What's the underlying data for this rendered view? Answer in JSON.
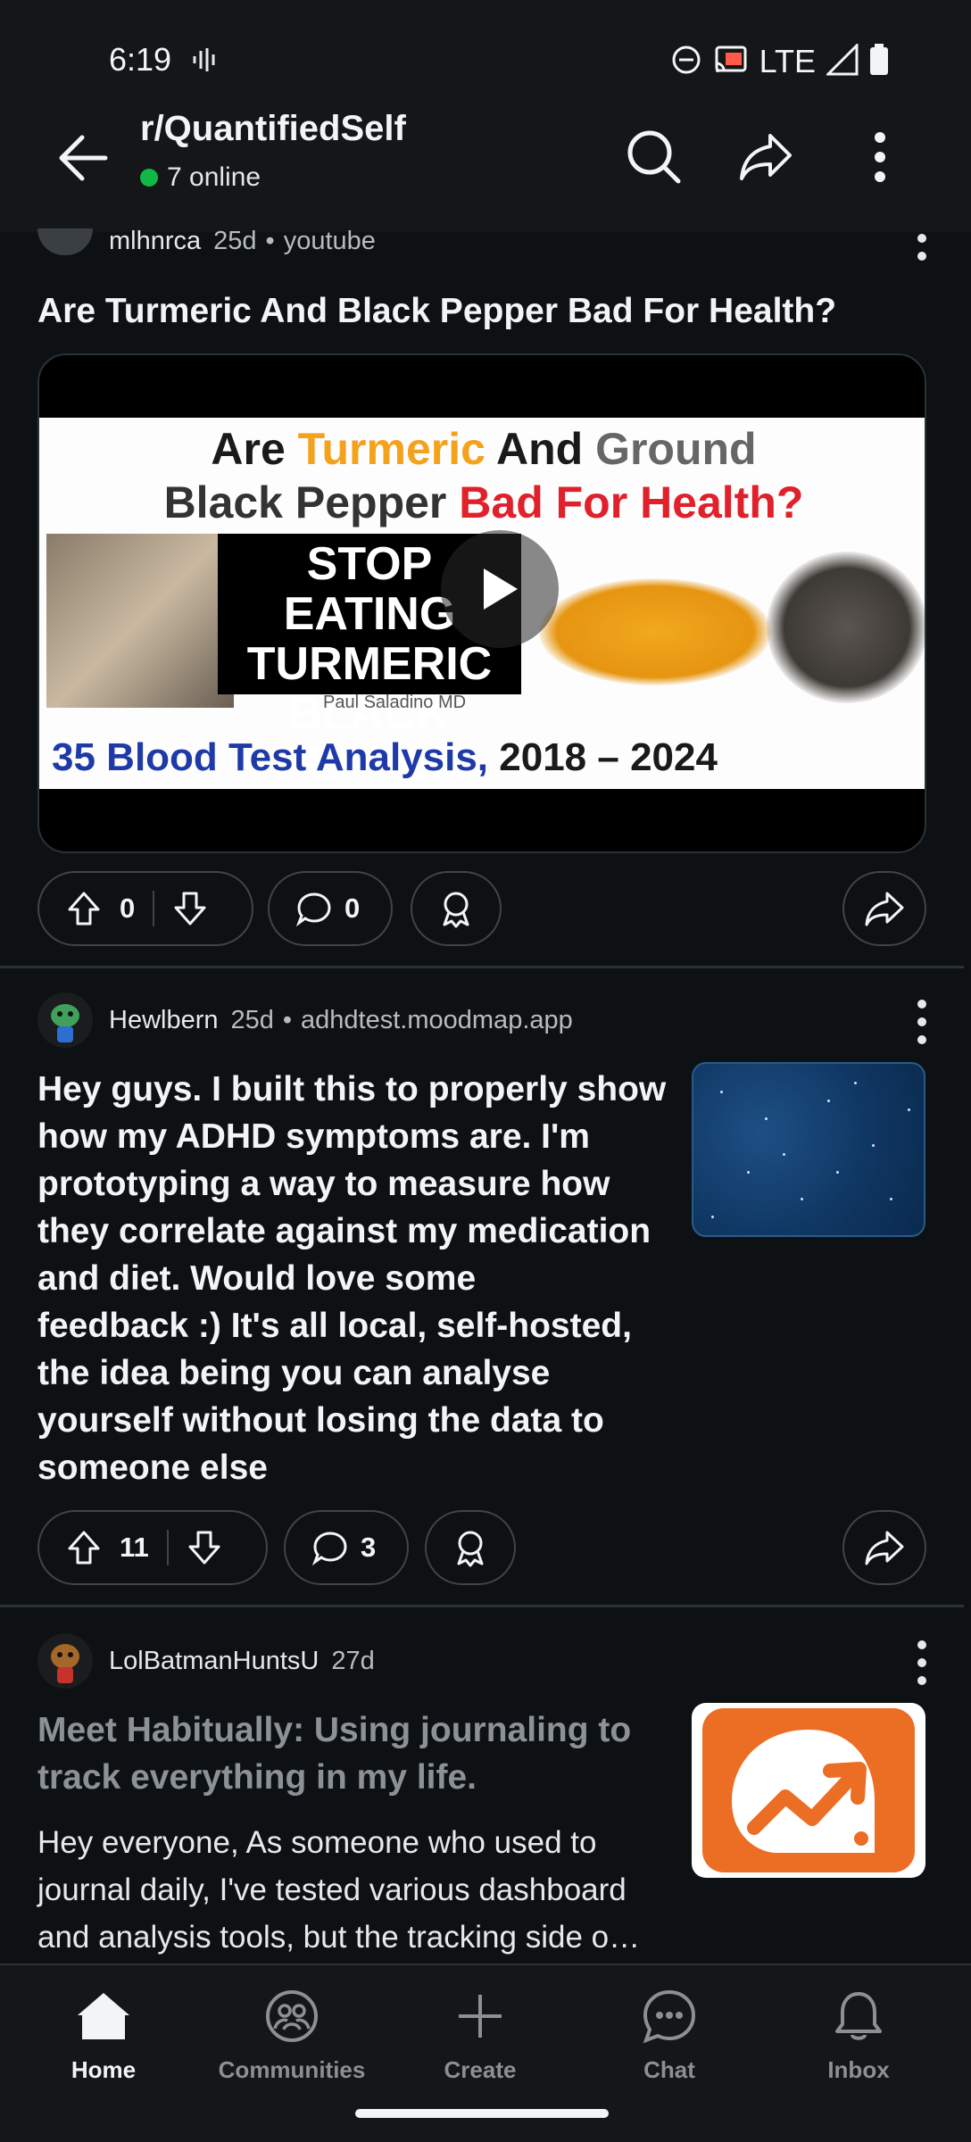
{
  "status_bar": {
    "time": "6:19",
    "network": "LTE"
  },
  "header": {
    "subreddit": "r/QuantifiedSelf",
    "online": "7 online"
  },
  "posts": [
    {
      "user": "mlhnrca",
      "age": "25d",
      "domain": "youtube",
      "title": "Are Turmeric And Black Pepper Bad For Health?",
      "video": {
        "line1_a": "Are ",
        "line1_b": "Turmeric",
        "line1_c": " And ",
        "line1_d": "Ground",
        "line2_a": "Black Pepper ",
        "line2_b": "Bad For Health?",
        "box_line1": "STOP EATING",
        "box_line2": "TURMERIC",
        "box_line3": "BLACK PEPPER",
        "credit": "Paul Saladino MD",
        "line3_a": "35 Blood Test Analysis, ",
        "line3_b": "2018 – 2024"
      },
      "score": "0",
      "comments": "0"
    },
    {
      "user": "Hewlbern",
      "age": "25d",
      "domain": "adhdtest.moodmap.app",
      "title_lines": [
        "Hey guys. I built this to properly show",
        "how my ADHD symptoms are. I'm",
        "prototyping a way to measure how",
        "they correlate against my medication",
        "and diet. Would love some",
        "feedback :) It's all local, self-hosted,",
        "the idea being you can analyse",
        "yourself without losing the data to",
        "someone else"
      ],
      "score": "11",
      "comments": "3"
    },
    {
      "user": "LolBatmanHuntsU",
      "age": "27d",
      "title_lines": [
        "Meet Habitually: Using journaling to",
        "track everything in my life."
      ],
      "body_lines": [
        "Hey everyone, As someone who used to",
        "journal daily, I've tested various dashboard",
        "and analysis tools, but the tracking side o…"
      ]
    }
  ],
  "nav": {
    "home": "Home",
    "communities": "Communities",
    "create": "Create",
    "chat": "Chat",
    "inbox": "Inbox"
  },
  "colors": {
    "accent_online": "#0fb847",
    "background": "#0e1113",
    "habit_orange": "#ec6d24"
  }
}
